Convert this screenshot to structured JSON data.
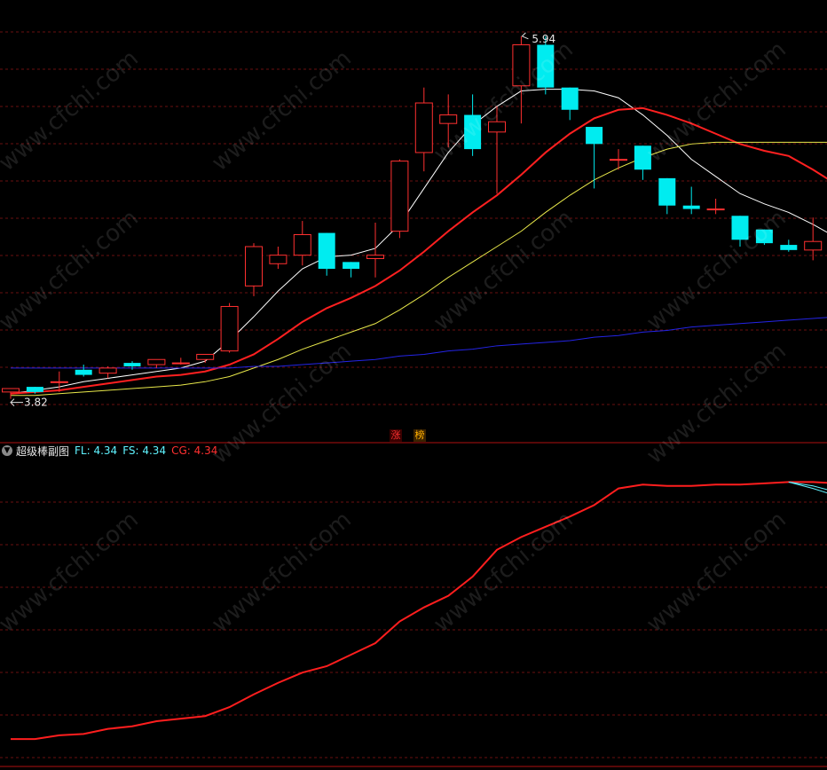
{
  "chart_data": [
    {
      "type": "candlestick",
      "panel": "main",
      "ylim": [
        3.6,
        6.1
      ],
      "annotations": {
        "high_label": "5.94",
        "low_label": "3.82"
      },
      "candles": [
        {
          "o": 3.86,
          "h": 3.88,
          "l": 3.82,
          "c": 3.88
        },
        {
          "o": 3.89,
          "h": 3.89,
          "l": 3.85,
          "c": 3.86
        },
        {
          "o": 3.92,
          "h": 3.98,
          "l": 3.86,
          "c": 3.92
        },
        {
          "o": 3.99,
          "h": 4.02,
          "l": 3.95,
          "c": 3.96
        },
        {
          "o": 3.97,
          "h": 4.01,
          "l": 3.94,
          "c": 4.0
        },
        {
          "o": 4.03,
          "h": 4.04,
          "l": 3.99,
          "c": 4.01
        },
        {
          "o": 4.02,
          "h": 4.04,
          "l": 4.0,
          "c": 4.05
        },
        {
          "o": 4.03,
          "h": 4.06,
          "l": 4.02,
          "c": 4.03
        },
        {
          "o": 4.05,
          "h": 4.07,
          "l": 4.03,
          "c": 4.08
        },
        {
          "o": 4.1,
          "h": 4.38,
          "l": 4.09,
          "c": 4.36
        },
        {
          "o": 4.48,
          "h": 4.73,
          "l": 4.42,
          "c": 4.71
        },
        {
          "o": 4.61,
          "h": 4.71,
          "l": 4.58,
          "c": 4.66
        },
        {
          "o": 4.66,
          "h": 4.86,
          "l": 4.6,
          "c": 4.78
        },
        {
          "o": 4.79,
          "h": 4.79,
          "l": 4.54,
          "c": 4.58
        },
        {
          "o": 4.62,
          "h": 4.62,
          "l": 4.53,
          "c": 4.58
        },
        {
          "o": 4.64,
          "h": 4.85,
          "l": 4.53,
          "c": 4.66
        },
        {
          "o": 4.8,
          "h": 5.22,
          "l": 4.76,
          "c": 5.21
        },
        {
          "o": 5.26,
          "h": 5.64,
          "l": 5.15,
          "c": 5.55
        },
        {
          "o": 5.43,
          "h": 5.6,
          "l": 5.29,
          "c": 5.48
        },
        {
          "o": 5.48,
          "h": 5.6,
          "l": 5.24,
          "c": 5.28
        },
        {
          "o": 5.38,
          "h": 5.53,
          "l": 5.02,
          "c": 5.44
        },
        {
          "o": 5.65,
          "h": 5.94,
          "l": 5.43,
          "c": 5.89
        },
        {
          "o": 5.89,
          "h": 5.94,
          "l": 5.6,
          "c": 5.64
        },
        {
          "o": 5.64,
          "h": 5.64,
          "l": 5.45,
          "c": 5.51
        },
        {
          "o": 5.41,
          "h": 5.41,
          "l": 5.05,
          "c": 5.31
        },
        {
          "o": 5.22,
          "h": 5.28,
          "l": 5.16,
          "c": 5.22
        },
        {
          "o": 5.3,
          "h": 5.3,
          "l": 5.1,
          "c": 5.16
        },
        {
          "o": 5.11,
          "h": 5.11,
          "l": 4.9,
          "c": 4.95
        },
        {
          "o": 4.95,
          "h": 5.06,
          "l": 4.9,
          "c": 4.93
        },
        {
          "o": 4.93,
          "h": 4.99,
          "l": 4.9,
          "c": 4.93
        },
        {
          "o": 4.89,
          "h": 4.89,
          "l": 4.71,
          "c": 4.75
        },
        {
          "o": 4.81,
          "h": 4.81,
          "l": 4.72,
          "c": 4.73
        },
        {
          "o": 4.72,
          "h": 4.75,
          "l": 4.68,
          "c": 4.69
        },
        {
          "o": 4.69,
          "h": 4.88,
          "l": 4.63,
          "c": 4.74
        },
        {
          "o": 4.69,
          "h": 4.69,
          "l": 4.62,
          "c": 4.62
        }
      ],
      "series": [
        {
          "color": "#ffffff",
          "values": [
            3.85,
            3.87,
            3.89,
            3.92,
            3.94,
            3.96,
            3.98,
            4.0,
            4.04,
            4.16,
            4.3,
            4.45,
            4.58,
            4.65,
            4.66,
            4.7,
            4.84,
            5.05,
            5.26,
            5.42,
            5.53,
            5.62,
            5.63,
            5.63,
            5.62,
            5.58,
            5.48,
            5.36,
            5.22,
            5.12,
            5.02,
            4.96,
            4.91,
            4.84,
            4.76
          ]
        },
        {
          "color": "#ff2020",
          "values": [
            3.85,
            3.86,
            3.87,
            3.89,
            3.91,
            3.93,
            3.95,
            3.96,
            3.98,
            4.02,
            4.08,
            4.17,
            4.27,
            4.35,
            4.41,
            4.48,
            4.57,
            4.68,
            4.8,
            4.91,
            5.01,
            5.13,
            5.26,
            5.37,
            5.46,
            5.51,
            5.52,
            5.48,
            5.43,
            5.37,
            5.31,
            5.27,
            5.24,
            5.16,
            5.07
          ]
        },
        {
          "color": "#e8e84a",
          "values": [
            3.84,
            3.84,
            3.85,
            3.86,
            3.87,
            3.88,
            3.89,
            3.9,
            3.92,
            3.95,
            4.0,
            4.05,
            4.11,
            4.16,
            4.21,
            4.26,
            4.34,
            4.43,
            4.53,
            4.62,
            4.71,
            4.8,
            4.91,
            5.01,
            5.1,
            5.17,
            5.23,
            5.28,
            5.31,
            5.32,
            5.32,
            5.32,
            5.32,
            5.32,
            5.32
          ]
        },
        {
          "color": "#2424e6",
          "values": [
            4.0,
            4.0,
            4.0,
            4.0,
            4.0,
            4.0,
            4.0,
            4.0,
            4.0,
            4.0,
            4.01,
            4.01,
            4.02,
            4.03,
            4.04,
            4.05,
            4.07,
            4.08,
            4.1,
            4.11,
            4.13,
            4.14,
            4.15,
            4.16,
            4.18,
            4.19,
            4.21,
            4.22,
            4.24,
            4.25,
            4.26,
            4.27,
            4.28,
            4.29,
            4.3
          ]
        }
      ]
    },
    {
      "type": "line",
      "panel": "sub",
      "title": "超级棒副图",
      "legend": [
        {
          "label": "FL: 4.34",
          "color": "#5ff3ff"
        },
        {
          "label": "FS: 4.34",
          "color": "#5ff3ff"
        },
        {
          "label": "CG: 4.34",
          "color": "#ff3030"
        }
      ],
      "ylim": [
        3.6,
        6.0
      ],
      "series": [
        {
          "name": "CG",
          "color": "#ff1e1e",
          "values": [
            3.8,
            3.8,
            3.83,
            3.84,
            3.88,
            3.9,
            3.94,
            3.96,
            3.98,
            4.05,
            4.15,
            4.24,
            4.32,
            4.37,
            4.46,
            4.55,
            4.72,
            4.83,
            4.92,
            5.07,
            5.28,
            5.38,
            5.46,
            5.54,
            5.63,
            5.76,
            5.79,
            5.78,
            5.78,
            5.79,
            5.79,
            5.8,
            5.81,
            5.81,
            5.8
          ]
        },
        {
          "name": "FL",
          "color": "#5ff3ff",
          "values": [
            null,
            null,
            null,
            null,
            null,
            null,
            null,
            null,
            null,
            null,
            null,
            null,
            null,
            null,
            null,
            null,
            null,
            null,
            null,
            null,
            null,
            null,
            null,
            null,
            null,
            null,
            null,
            null,
            null,
            null,
            null,
            null,
            5.81,
            5.76,
            5.7
          ]
        },
        {
          "name": "FS",
          "color": "#5ff3ff",
          "values": [
            null,
            null,
            null,
            null,
            null,
            null,
            null,
            null,
            null,
            null,
            null,
            null,
            null,
            null,
            null,
            null,
            null,
            null,
            null,
            null,
            null,
            null,
            null,
            null,
            null,
            null,
            null,
            null,
            null,
            null,
            null,
            null,
            5.81,
            5.78,
            5.73
          ]
        }
      ]
    }
  ],
  "badges": [
    {
      "text": "涨",
      "color": "#ff3030",
      "bg": "#3a0000"
    },
    {
      "text": "榜",
      "color": "#ffb000",
      "bg": "#3a2200"
    }
  ],
  "watermark": "www.cfchi.com",
  "colors": {
    "up": "#ff3030",
    "down": "#00ecf0",
    "grid": "#6a1010",
    "divider": "#b01010"
  }
}
